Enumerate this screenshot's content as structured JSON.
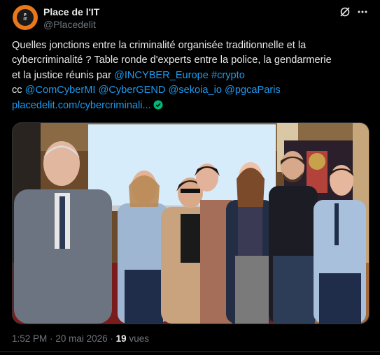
{
  "author": {
    "display_name": "Place de l'IT",
    "handle": "@Placedelit",
    "avatar_text": "Place\nde\nl'IT"
  },
  "tweet": {
    "line1": "Quelles jonctions entre la criminalité organisée traditionnelle et la",
    "line2": "cybercriminalité ? Table ronde d'experts entre la police, la gendarmerie",
    "line3_text": "et la justice réunis par ",
    "mention_incyber": "@INCYBER_Europe",
    "hashtag_crypto": "#crypto",
    "cc": "cc ",
    "mention_comcybermi": "@ComCyberMI",
    "mention_cybergend": "@CyberGEND",
    "mention_sekoia": "@sekoia_io",
    "mention_pgcaparis": "@pgcaParis",
    "link": "placedelit.com/cybercriminali..."
  },
  "meta": {
    "time": "1:52 PM",
    "separator": "·",
    "date": "20 mai 2026",
    "views_count": "19",
    "views_label": "vues"
  },
  "colors": {
    "background": "#000000",
    "text": "#e7e9ea",
    "secondary": "#71767b",
    "link": "#1d9bf0",
    "verified": "#00b87a",
    "avatar": "#e8781a"
  },
  "icons": [
    "grok-icon",
    "more-icon",
    "verified-icon"
  ]
}
